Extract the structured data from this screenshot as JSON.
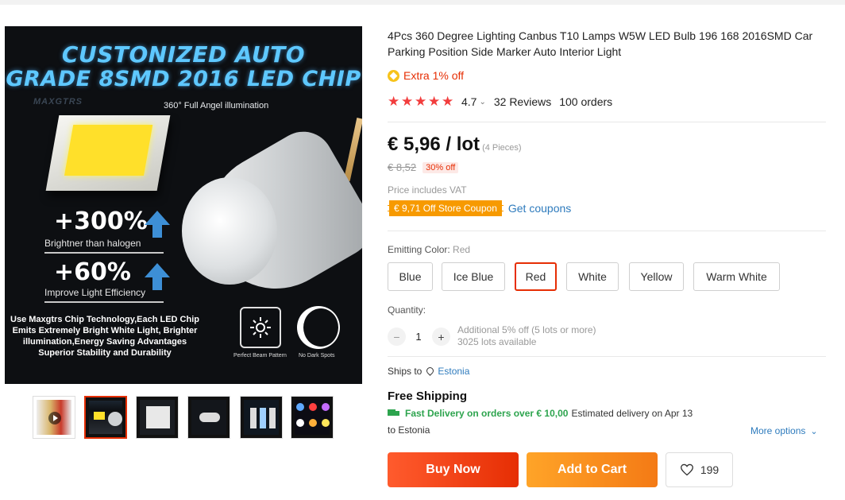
{
  "gallery": {
    "main_image": {
      "headline_line1": "CUSTONIZED AUTO",
      "headline_line2": "GRADE 8SMD 2016 LED CHIP",
      "watermark": "MAXGTRS",
      "angel_text": "360° Full Angel illumination",
      "stat1_big": "+300%",
      "stat1_sub": "Brightner than halogen",
      "stat2_big": "+60%",
      "stat2_sub": "Improve Light Efficiency",
      "description": "Use Maxgtrs Chip Technology,Each LED Chip Emits Extremely Bright White Light, Brighter illumination,Energy Saving Advantages Superior Stability and Durability",
      "feature1": "Perfect Beam Pattern",
      "feature2": "No Dark Spots"
    },
    "thumbnails_count": 6,
    "active_thumbnail": 2
  },
  "product": {
    "title": "4Pcs 360 Degree Lighting Canbus T10 Lamps W5W LED Bulb 196 168 2016SMD Car Parking Position Side Marker Auto Interior Light",
    "extra_off": "Extra 1% off",
    "rating": "4.7",
    "reviews": "32 Reviews",
    "orders": "100 orders",
    "stars": 5
  },
  "pricing": {
    "price": "€ 5,96 / lot",
    "pieces": "(4 Pieces)",
    "old_price": "€ 8,52",
    "discount": "30% off",
    "vat_note": "Price includes VAT",
    "coupon": "€ 9,71 Off Store Coupon",
    "get_coupons": "Get coupons"
  },
  "options": {
    "label": "Emitting Color:",
    "selected_value": "Red",
    "colors": [
      "Blue",
      "Ice Blue",
      "Red",
      "White",
      "Yellow",
      "Warm White"
    ]
  },
  "quantity": {
    "label": "Quantity:",
    "value": "1",
    "minus": "−",
    "plus": "+",
    "info_line1": "Additional 5% off (5 lots or more)",
    "info_line2": "3025 lots available"
  },
  "shipping": {
    "ships_to_label": "Ships to",
    "ships_to_country": "Estonia",
    "free_shipping": "Free Shipping",
    "fast_delivery": "Fast Delivery on orders over € 10,00",
    "estimated": "Estimated delivery on Apr 13",
    "to_country": "to Estonia",
    "more_options": "More options"
  },
  "actions": {
    "buy_now": "Buy Now",
    "add_to_cart": "Add to Cart",
    "wishlist_count": "199"
  },
  "colors": {
    "accent_red": "#e62e04",
    "orange": "#f79a00",
    "link_blue": "#2e7bbd",
    "green": "#2da44e",
    "star_red": "#f23d3d"
  }
}
